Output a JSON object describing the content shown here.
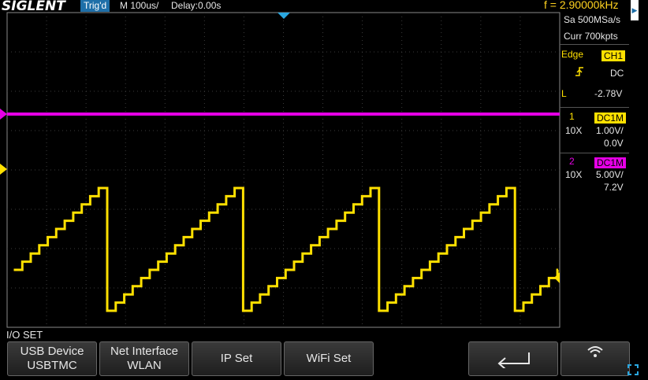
{
  "topbar": {
    "logo": "SIGLENT",
    "trig_status": "Trig'd",
    "timebase": "M 100us/",
    "delay": "Delay:0.00s",
    "frequency": "f = 2.90000kHz"
  },
  "acquisition": {
    "sample_rate": "Sa 500MSa/s",
    "memory": "Curr 700kpts"
  },
  "trigger": {
    "type": "Edge",
    "source": "CH1",
    "coupling": "DC",
    "level_prefix": "L",
    "level": "-2.78V"
  },
  "channels": [
    {
      "number": "1",
      "coupling": "DC1M",
      "probe": "10X",
      "scale": "1.00V/",
      "offset": "0.0V",
      "color": "#ffe000"
    },
    {
      "number": "2",
      "coupling": "DC1M",
      "probe": "10X",
      "scale": "5.00V/",
      "offset": "7.2V",
      "color": "#e600e6"
    }
  ],
  "menu": {
    "title": "I/O SET",
    "softkeys": [
      {
        "line1": "USB Device",
        "line2": "USBTMC"
      },
      {
        "line1": "Net Interface",
        "line2": "WLAN"
      },
      {
        "line1": "IP Set",
        "line2": ""
      },
      {
        "line1": "WiFi Set",
        "line2": ""
      }
    ],
    "back_icon": "return-arrow-icon",
    "wifi_icon": "wifi-icon"
  },
  "colors": {
    "ch1": "#ffe000",
    "ch2": "#e600e6",
    "trig_status_bg": "#1e6fa8",
    "frequency": "#ffd21f"
  }
}
